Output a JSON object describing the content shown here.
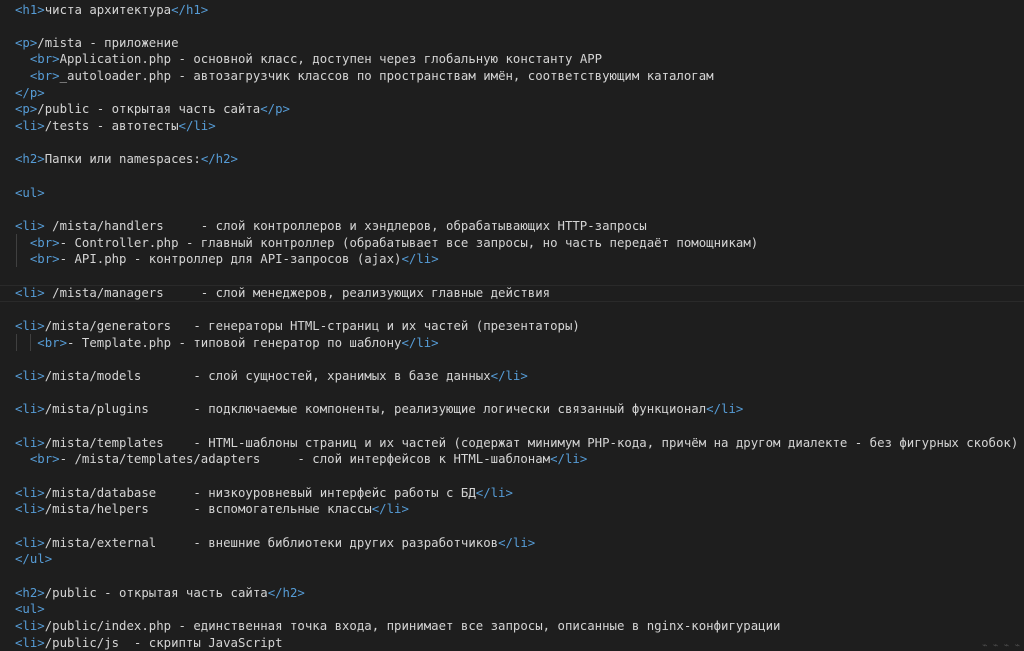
{
  "editor": {
    "lines": [
      [
        "<h1>",
        "чиста архитектура",
        "</h1>"
      ],
      [],
      [
        "<p>",
        "/mista - приложение"
      ],
      [
        "  ",
        "<br>",
        "Application.php - основной класс, доступен через глобальную константу APP"
      ],
      [
        "  ",
        "<br>",
        "_autoloader.php - автозагрузчик классов по пространствам имён, соответствующим каталогам"
      ],
      [
        "</p>"
      ],
      [
        "<p>",
        "/public - открытая часть сайта",
        "</p>"
      ],
      [
        "<li>",
        "/tests - автотесты",
        "</li>"
      ],
      [],
      [
        "<h2>",
        "Папки или namespaces:",
        "</h2>"
      ],
      [],
      [
        "<ul>"
      ],
      [],
      [
        "<li>",
        " /mista/handlers     - слой контроллеров и хэндлеров, обрабатывающих HTTP-запросы"
      ],
      [
        "  ",
        "<br>",
        "- Controller.php - главный контроллер (обрабатывает все запросы, но часть передаёт помощникам)"
      ],
      [
        "  ",
        "<br>",
        "- API.php - контроллер для API-запросов (ajax)",
        "</li>"
      ],
      [],
      [
        "<li>",
        " /mista/managers     - слой менеджеров, реализующих главные действия"
      ],
      [],
      [
        "<li>",
        "/mista/generators   - генераторы HTML-страниц и их частей (презентаторы)"
      ],
      [
        "   ",
        "<br>",
        "- Template.php - типовой генератор по шаблону",
        "</li>"
      ],
      [],
      [
        "<li>",
        "/mista/models       - слой сущностей, хранимых в базе данных",
        "</li>"
      ],
      [],
      [
        "<li>",
        "/mista/plugins      - подключаемые компоненты, реализующие логически связанный функционал",
        "</li>"
      ],
      [],
      [
        "<li>",
        "/mista/templates    - HTML-шаблоны страниц и их частей (содержат минимум PHP-кода, причём на другом диалекте - без фигурных скобок)"
      ],
      [
        "  ",
        "<br>",
        "- /mista/templates/adapters     - слой интерфейсов к HTML-шаблонам",
        "</li>"
      ],
      [],
      [
        "<li>",
        "/mista/database     - низкоуровневый интерфейс работы с БД",
        "</li>"
      ],
      [
        "<li>",
        "/mista/helpers      - вспомогательные классы",
        "</li>"
      ],
      [],
      [
        "<li>",
        "/mista/external     - внешние библиотеки других разработчиков",
        "</li>"
      ],
      [
        "</ul>"
      ],
      [],
      [
        "<h2>",
        "/public - открытая часть сайта",
        "</h2>"
      ],
      [
        "<ul>"
      ],
      [
        "<li>",
        "/public/index.php - единственная точка входа, принимает все запросы, описанные в nginx-конфигурации"
      ],
      [
        "<li>",
        "/public/js  - скрипты JavaScript"
      ]
    ]
  },
  "colors": {
    "background": "#1e1e1e",
    "tag": "#569cd6",
    "text": "#d4d4d4"
  }
}
